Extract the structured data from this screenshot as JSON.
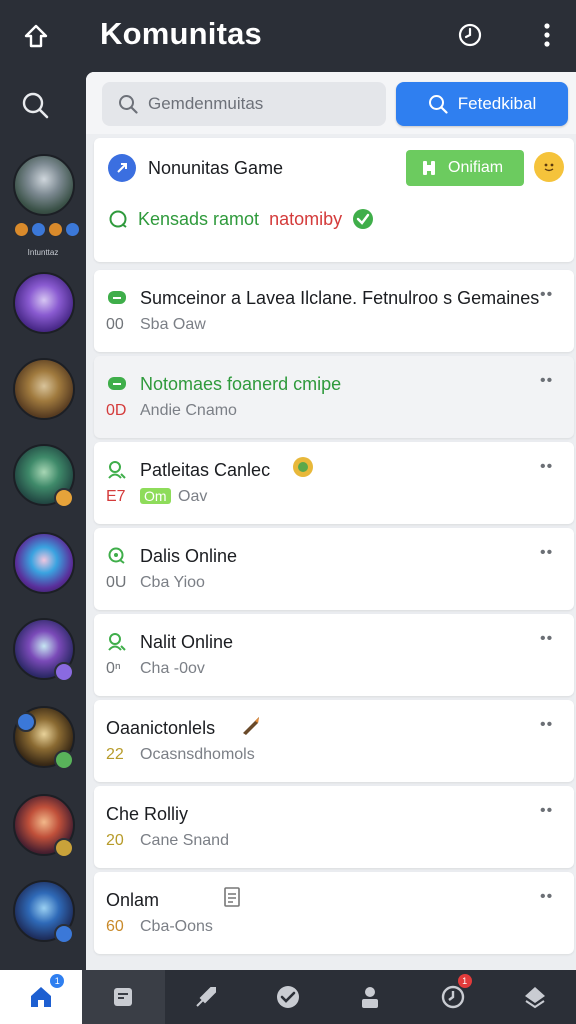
{
  "header": {
    "title": "Komunitas"
  },
  "search": {
    "placeholder": "Gemdenmuitas",
    "button_label": "Fetedkibal"
  },
  "sidebar": {
    "caption": "Intunttaz"
  },
  "community": {
    "name": "Nonunitas Game",
    "status": "Onifiam",
    "note_green": "Kensads ramot",
    "note_red": "natomiby"
  },
  "threads": [
    {
      "title": "Sumceinor a Lavea Ilclane. Fetnulroo s Gemaines",
      "count": "00",
      "subtitle": "Sba Oaw",
      "title_color": "#1b1d21",
      "count_color": "#707479"
    },
    {
      "title": "Notomaes foanerd cmipe",
      "count": "0D",
      "subtitle": "Andie Cnamo",
      "title_color": "#2f9a3c",
      "count_color": "#d43b3b"
    },
    {
      "title": "Patleitas Canlec",
      "count": "E7",
      "tag": "Om",
      "subtitle": "Oav",
      "title_color": "#1b1d21",
      "count_color": "#d43b3b"
    },
    {
      "title": "Dalis Online",
      "count": "0U",
      "subtitle": "Cba Yioo",
      "title_color": "#1b1d21",
      "count_color": "#707479"
    },
    {
      "title": "Nalit Online",
      "count": "0ⁿ",
      "subtitle": "Cha -0ov",
      "title_color": "#1b1d21",
      "count_color": "#707479"
    },
    {
      "title": "Oaanictonlels",
      "count": "22",
      "subtitle": "Ocasnsdhomols",
      "title_color": "#1b1d21",
      "count_color": "#b79b2a"
    },
    {
      "title": "Che Rolliy",
      "count": "20",
      "subtitle": "Cane Snand",
      "title_color": "#1b1d21",
      "count_color": "#b79b2a"
    },
    {
      "title": "Onlam",
      "count": "60",
      "subtitle": "Cba-Oons",
      "title_color": "#1b1d21",
      "count_color": "#c98a2a"
    }
  ],
  "more_glyph": "••",
  "nav": {
    "home_badge": "1",
    "clock_badge": "1"
  },
  "colors": {
    "accent": "#2f7ff0",
    "online": "#6ccb5f",
    "dark_bg": "#2b2f37"
  }
}
